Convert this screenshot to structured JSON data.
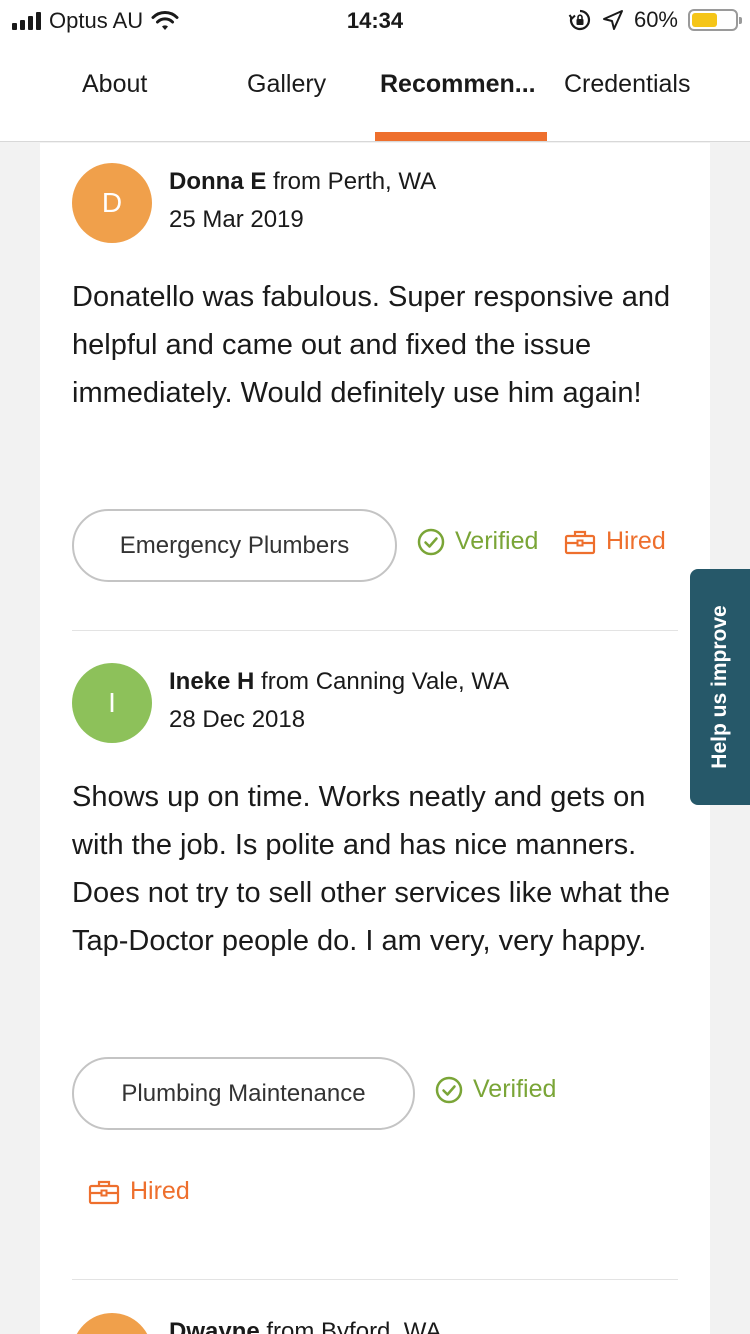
{
  "status_bar": {
    "carrier": "Optus AU",
    "time": "14:34",
    "battery_percent": "60%",
    "battery_level": 0.6
  },
  "tabs": [
    {
      "label": "About"
    },
    {
      "label": "Gallery"
    },
    {
      "label": "Recommen..."
    },
    {
      "label": "Credentials"
    }
  ],
  "active_tab": "Recommen...",
  "reviews": [
    {
      "initial": "D",
      "avatar_color": "#f0a04b",
      "name": "Donna E",
      "location": "from Perth, WA",
      "date": "25 Mar 2019",
      "text": "Donatello was fabulous. Super responsive and helpful and came out and fixed the issue immediately. Would definitely use him again!",
      "category": "Emergency Plumbers",
      "verified": "Verified",
      "hired": "Hired"
    },
    {
      "initial": "I",
      "avatar_color": "#8dc15a",
      "name": "Ineke H",
      "location": "from Canning Vale, WA",
      "date": "28 Dec 2018",
      "text": "Shows up on time. Works neatly and gets on with the job. Is polite and has nice manners. Does not try to sell other services like what the Tap-Doctor people do. I am very, very happy.",
      "category": "Plumbing Maintenance",
      "verified": "Verified",
      "hired": "Hired"
    },
    {
      "initial": "",
      "avatar_color": "#f0a04b",
      "name": "Dwayne",
      "location": "from Byford, WA"
    }
  ],
  "help_tab": "Help us improve",
  "colors": {
    "accent": "#ee6f2d",
    "verified": "#7aa537",
    "help_tab_bg": "#265869"
  }
}
